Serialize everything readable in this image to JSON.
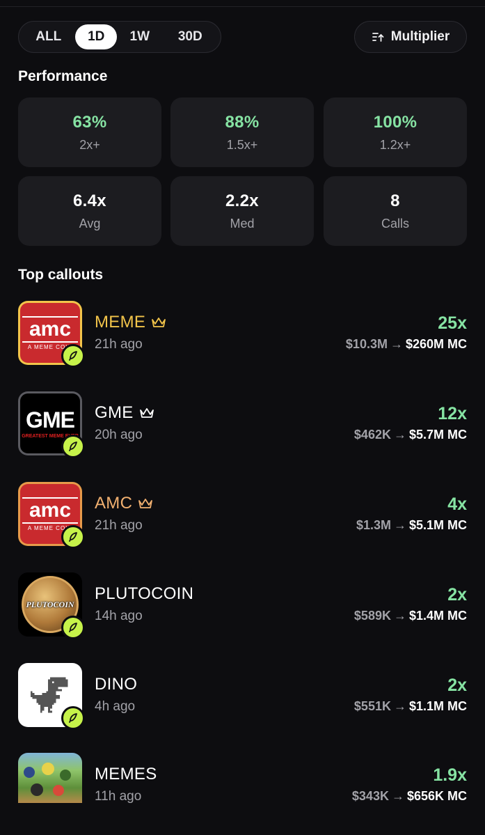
{
  "tabs": [
    {
      "label": "ALL",
      "active": false
    },
    {
      "label": "1D",
      "active": true
    },
    {
      "label": "1W",
      "active": false
    },
    {
      "label": "30D",
      "active": false
    }
  ],
  "multiplier_button": {
    "label": "Multiplier",
    "icon": "sort-ascending-icon"
  },
  "performance": {
    "title": "Performance",
    "cards": [
      {
        "value": "63%",
        "label": "2x+",
        "color": "#86e3a3"
      },
      {
        "value": "88%",
        "label": "1.5x+",
        "color": "#86e3a3"
      },
      {
        "value": "100%",
        "label": "1.2x+",
        "color": "#86e3a3"
      },
      {
        "value": "6.4x",
        "label": "Avg",
        "color": "#ffffff"
      },
      {
        "value": "2.2x",
        "label": "Med",
        "color": "#ffffff"
      },
      {
        "value": "8",
        "label": "Calls",
        "color": "#ffffff"
      }
    ]
  },
  "callouts": {
    "title": "Top callouts",
    "items": [
      {
        "name": "MEME",
        "crown": true,
        "name_color": "#f2c44a",
        "time": "21h ago",
        "multiplier": "25x",
        "mc_from": "$10.3M",
        "mc_to": "$260M MC",
        "thumb_text": "amc",
        "thumb_sub": "A MEME COIN"
      },
      {
        "name": "GME",
        "crown": true,
        "name_color": "#ffffff",
        "time": "20h ago",
        "multiplier": "12x",
        "mc_from": "$462K",
        "mc_to": "$5.7M MC",
        "thumb_text": "GME",
        "thumb_sub": "GREATEST MEME EVER"
      },
      {
        "name": "AMC",
        "crown": true,
        "name_color": "#f1b070",
        "time": "21h ago",
        "multiplier": "4x",
        "mc_from": "$1.3M",
        "mc_to": "$5.1M MC",
        "thumb_text": "amc",
        "thumb_sub": "A MEME COIN"
      },
      {
        "name": "PLUTOCOIN",
        "crown": false,
        "name_color": "#ffffff",
        "time": "14h ago",
        "multiplier": "2x",
        "mc_from": "$589K",
        "mc_to": "$1.4M MC",
        "thumb_text": "PLUTOCOIN"
      },
      {
        "name": "DINO",
        "crown": false,
        "name_color": "#ffffff",
        "time": "4h ago",
        "multiplier": "2x",
        "mc_from": "$551K",
        "mc_to": "$1.1M MC"
      },
      {
        "name": "MEMES",
        "crown": false,
        "name_color": "#ffffff",
        "time": "11h ago",
        "multiplier": "1.9x",
        "mc_from": "$343K",
        "mc_to": "$656K MC"
      }
    ],
    "arrow": "→"
  }
}
